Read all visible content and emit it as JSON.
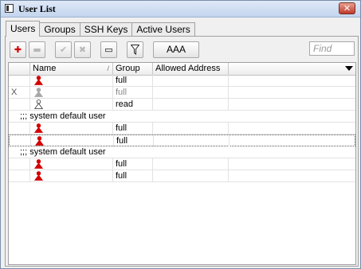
{
  "window": {
    "title": "User List",
    "close_glyph": "✕"
  },
  "tabs": [
    "Users",
    "Groups",
    "SSH Keys",
    "Active Users"
  ],
  "toolbar": {
    "add_glyph": "✚",
    "remove_glyph": "▬",
    "enable_glyph": "✔",
    "disable_glyph": "✖",
    "comment_glyph": "▭",
    "filter_glyph": "⏷",
    "aaa_label": "AAA",
    "find_placeholder": "Find"
  },
  "columns": [
    "Name",
    "Group",
    "Allowed Address"
  ],
  "sort_indicator": "/",
  "rows": [
    {
      "type": "user",
      "flag": "",
      "icon": "user-icon-red",
      "group": "full"
    },
    {
      "type": "user",
      "flag": "X",
      "icon": "user-icon-gray",
      "group": "full",
      "disabled": true
    },
    {
      "type": "user",
      "flag": "",
      "icon": "user-icon-white",
      "group": "read"
    },
    {
      "type": "comment",
      "text": ";;; system default user"
    },
    {
      "type": "user",
      "flag": "",
      "icon": "user-icon-red",
      "group": "full"
    },
    {
      "type": "user",
      "flag": "",
      "icon": "user-icon-red",
      "group": "full",
      "selected": true
    },
    {
      "type": "comment",
      "text": ";;; system default user"
    },
    {
      "type": "user",
      "flag": "",
      "icon": "user-icon-red",
      "group": "full"
    },
    {
      "type": "user",
      "flag": "",
      "icon": "user-icon-red",
      "group": "full"
    }
  ],
  "colors": {
    "user_red": "#d40000",
    "user_gray": "#a8a8a8",
    "user_white": "#ffffff"
  }
}
